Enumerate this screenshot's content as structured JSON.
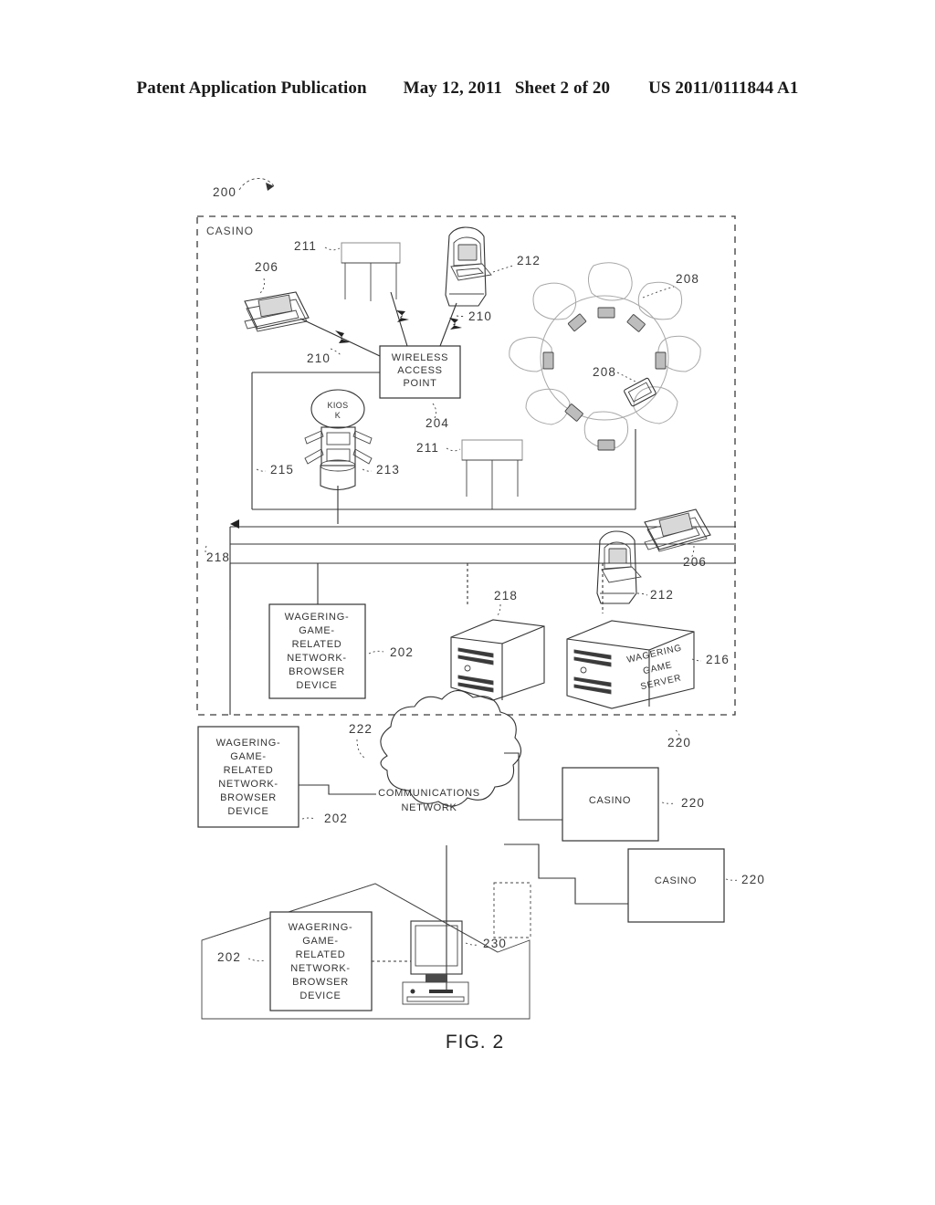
{
  "header": {
    "publication": "Patent Application Publication",
    "date": "May 12, 2011",
    "sheet": "Sheet 2 of 20",
    "patent_number": "US 2011/0111844 A1"
  },
  "figure": {
    "caption": "FIG. 2",
    "system_ref": "200",
    "casino_label": "CASINO"
  },
  "boxes": {
    "wireless_access_point": {
      "lines": [
        "WIRELESS",
        "ACCESS",
        "POINT"
      ],
      "ref": "204"
    },
    "kiosk": {
      "lines": [
        "KIOS",
        "K"
      ],
      "ref_left": "215",
      "ref_right": "213"
    },
    "browser_device_casino": {
      "lines": [
        "WAGERING-",
        "GAME-",
        "RELATED",
        "NETWORK-",
        "BROWSER",
        "DEVICE"
      ],
      "ref": "202"
    },
    "browser_device_standalone": {
      "lines": [
        "WAGERING-",
        "GAME-",
        "RELATED",
        "NETWORK-",
        "BROWSER",
        "DEVICE"
      ],
      "ref": "202"
    },
    "browser_device_home": {
      "lines": [
        "WAGERING-",
        "GAME-",
        "RELATED",
        "NETWORK-",
        "BROWSER",
        "DEVICE"
      ],
      "ref": "202"
    },
    "wagering_game_server": {
      "lines": [
        "WAGERING",
        "GAME",
        "SERVER"
      ],
      "ref": "216"
    },
    "second_server": {
      "ref": "218"
    },
    "communications_network": {
      "lines": [
        "COMMUNICATIONS",
        "NETWORK"
      ],
      "ref": "222"
    },
    "casino_remote_1": {
      "label": "CASINO",
      "ref": "220"
    },
    "casino_remote_2": {
      "label": "CASINO",
      "ref": "220"
    },
    "casino_remote_group_ref": "220",
    "home_computer": {
      "ref": "230"
    }
  },
  "refs": {
    "handheld_top": "206",
    "handheld_lower": "206",
    "table_top": "211",
    "table_mid": "211",
    "slot_top": "212",
    "slot_lower": "212",
    "wireless_link_left": "210",
    "wireless_link_mid": "210",
    "wireless_link_right": "210",
    "gaming_table": "208",
    "gaming_table_seats": "208",
    "network_backbone": "218"
  }
}
